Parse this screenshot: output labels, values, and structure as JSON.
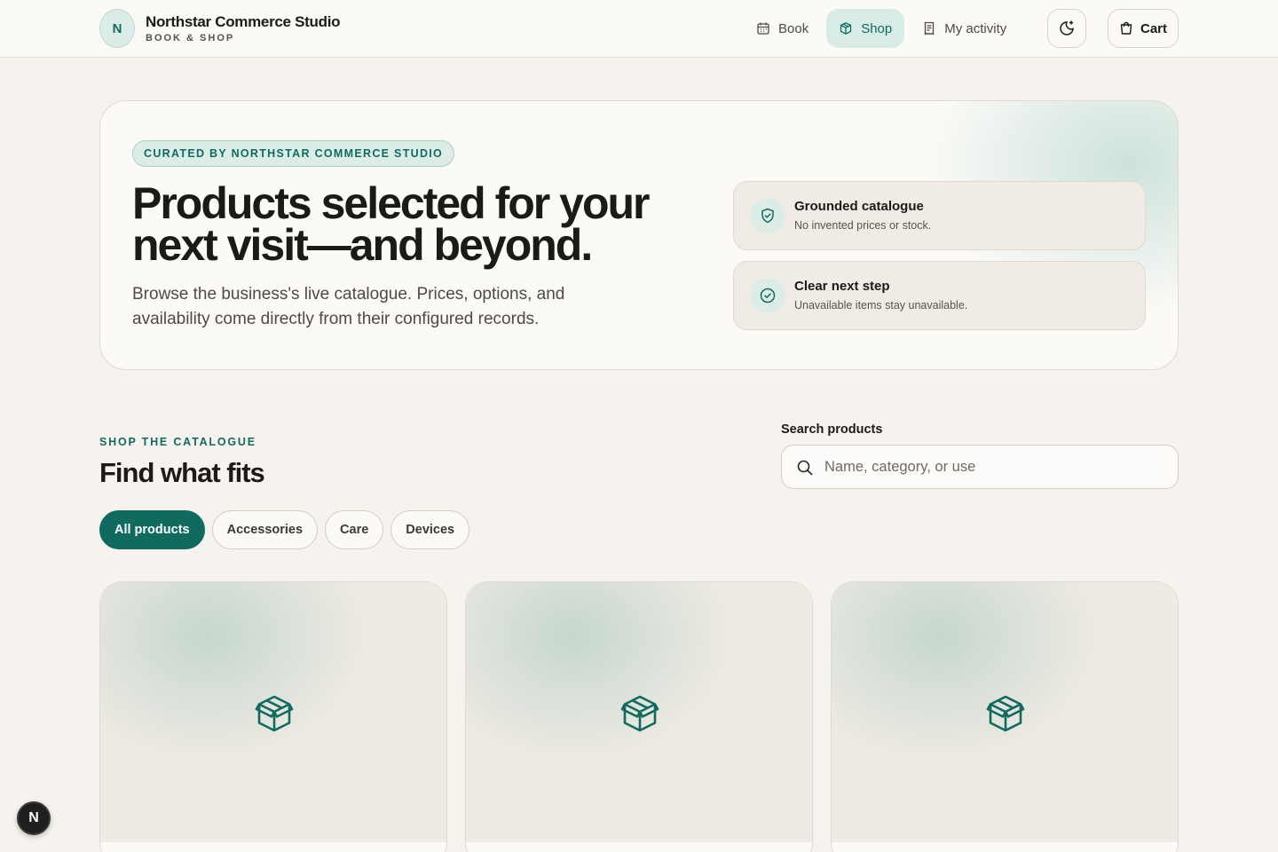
{
  "header": {
    "brand_initial": "N",
    "brand_name": "Northstar Commerce Studio",
    "brand_sub": "BOOK & SHOP",
    "nav": [
      {
        "label": "Book",
        "icon": "calendar-icon"
      },
      {
        "label": "Shop",
        "icon": "box-icon",
        "active": true
      },
      {
        "label": "My activity",
        "icon": "receipt-icon"
      }
    ],
    "theme_toggle_icon": "moon-icon",
    "cart_label": "Cart"
  },
  "hero": {
    "badge": "CURATED BY NORTHSTAR COMMERCE STUDIO",
    "title": "Products selected for your next visit—and beyond.",
    "description": "Browse the business's live catalogue. Prices, options, and availability come directly from their configured records.",
    "features": [
      {
        "title": "Grounded catalogue",
        "description": "No invented prices or stock.",
        "icon": "shield-check-icon"
      },
      {
        "title": "Clear next step",
        "description": "Unavailable items stay unavailable.",
        "icon": "check-circle-icon"
      }
    ]
  },
  "catalogue": {
    "eyebrow": "SHOP THE CATALOGUE",
    "title": "Find what fits",
    "search": {
      "label": "Search products",
      "placeholder": "Name, category, or use",
      "value": ""
    },
    "filters": [
      {
        "label": "All products",
        "active": true
      },
      {
        "label": "Accessories"
      },
      {
        "label": "Care"
      },
      {
        "label": "Devices"
      }
    ],
    "products": [
      {
        "icon": "package-icon"
      },
      {
        "icon": "package-icon"
      },
      {
        "icon": "package-icon"
      }
    ]
  },
  "floating_badge": "N",
  "colors": {
    "accent": "#116a5f",
    "accent_soft": "#d8ece7",
    "background": "#f6f3ee",
    "surface": "#fbfaf7"
  }
}
